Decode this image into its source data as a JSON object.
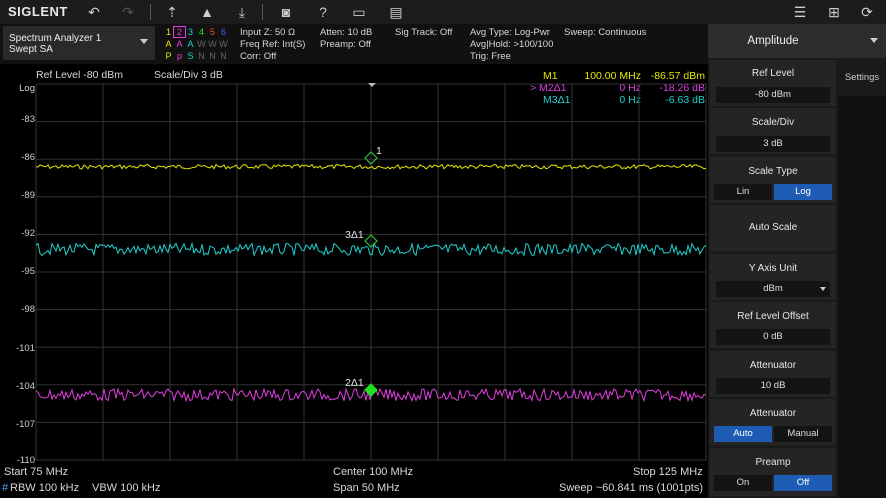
{
  "toolbar": {
    "logo": "SIGLENT",
    "icons": [
      "undo-icon",
      "redo-icon",
      "peak-search-icon",
      "marker-icon",
      "marker-to-icon",
      "screenshot-icon",
      "help-icon",
      "folder-icon",
      "message-icon",
      "menu-list-icon",
      "network-icon",
      "power-icon"
    ]
  },
  "analyzer": {
    "name": "Spectrum Analyzer 1",
    "mode": "Swept SA"
  },
  "traces": {
    "numbers": [
      "1",
      "2",
      "3",
      "4",
      "5",
      "6"
    ],
    "number_colors": [
      "#e6e600",
      "#e040e0",
      "#20d0d0",
      "#30e030",
      "#ff4040",
      "#4060ff"
    ],
    "modes": [
      "A",
      "A",
      "A",
      "W",
      "W",
      "W"
    ],
    "detectors": [
      "P",
      "p",
      "S",
      "N",
      "N",
      "N"
    ]
  },
  "info": {
    "input_z": "Input Z: 50 Ω",
    "freq_ref": "Freq Ref: Int(S)",
    "corr": "Corr: Off",
    "atten": "Atten: 10 dB",
    "preamp": "Preamp: Off",
    "sig_track": "Sig Track: Off",
    "avg_type": "Avg Type: Log-Pwr",
    "avg_hold": "Avg|Hold: >100/100",
    "trig": "Trig: Free",
    "sweep": "Sweep: Continuous"
  },
  "plot": {
    "ref_level": "Ref Level  -80 dBm",
    "scale_div": "Scale/Div  3 dB",
    "log_label": "Log",
    "y_ticks": [
      "-83",
      "-86",
      "-89",
      "-92",
      "-95",
      "-98",
      "-101",
      "-104",
      "-107",
      "-110"
    ],
    "markers": [
      {
        "name": "M1",
        "freq": "100.00 MHz",
        "value": "-86.57 dBm",
        "color": "#e6e600"
      },
      {
        "name": "> M2Δ1",
        "freq": "0 Hz",
        "value": "-18.26 dB",
        "color": "#e040e0"
      },
      {
        "name": "M3Δ1",
        "freq": "0 Hz",
        "value": "-6.63 dB",
        "color": "#20d0d0"
      }
    ],
    "marker_labels": {
      "m1": "1",
      "m2": "2Δ1",
      "m3": "3Δ1"
    },
    "trace_colors": {
      "t1": "#e6e600",
      "t2": "#e040e0",
      "t3": "#20d0d0"
    },
    "trace_levels_dbm": {
      "t1": -86.6,
      "t2": -104.8,
      "t3": -93.2
    }
  },
  "bottom": {
    "start": "Start  75 MHz",
    "center": "Center  100 MHz",
    "stop": "Stop  125 MHz",
    "rbw_mark": "#",
    "rbw": "RBW  100 kHz",
    "vbw": "VBW  100 kHz",
    "span": "Span  50 MHz",
    "sweep": "Sweep  ~60.841 ms (1001pts)"
  },
  "panel": {
    "title": "Amplitude",
    "settings_tab": "Settings",
    "ref_level": {
      "label": "Ref Level",
      "value": "-80 dBm"
    },
    "scale_div": {
      "label": "Scale/Div",
      "value": "3 dB"
    },
    "scale_type": {
      "label": "Scale Type",
      "options": [
        "Lin",
        "Log"
      ]
    },
    "auto_scale": {
      "label": "Auto Scale"
    },
    "y_axis_unit": {
      "label": "Y Axis Unit",
      "value": "dBm"
    },
    "ref_level_offset": {
      "label": "Ref Level Offset",
      "value": "0 dB"
    },
    "attenuator_value": {
      "label": "Attenuator",
      "value": "10 dB"
    },
    "attenuator_mode": {
      "label": "Attenuator",
      "options": [
        "Auto",
        "Manual"
      ]
    },
    "preamp": {
      "label": "Preamp",
      "options": [
        "On",
        "Off"
      ]
    }
  }
}
